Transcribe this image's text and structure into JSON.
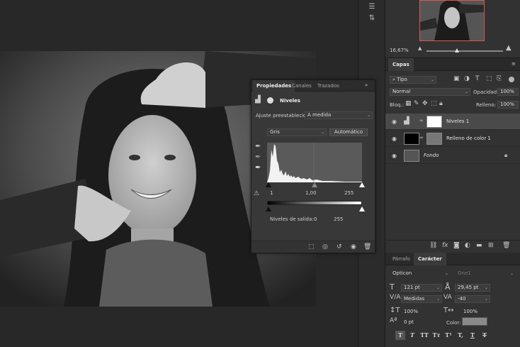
{
  "navigator": {
    "zoom": "16,67%"
  },
  "layers_panel": {
    "tab": "Capas",
    "filter": "Tipo",
    "blend_mode": "Normal",
    "opacity_label": "Opacidad:",
    "opacity_value": "100%",
    "lock_label": "Bloq.:",
    "fill_label": "Relleno:",
    "fill_value": "100%",
    "layers": [
      {
        "name": "Niveles 1",
        "selected": true
      },
      {
        "name": "Relleno de color 1",
        "selected": false
      },
      {
        "name": "Fondo",
        "selected": false
      }
    ]
  },
  "properties_panel": {
    "tabs": [
      "Propiedades",
      "Canales",
      "Trazados"
    ],
    "title": "Niveles",
    "preset_label": "Ajuste preestablecido:",
    "preset_value": "A medida",
    "channel": "Gris",
    "auto_button": "Automático",
    "input_black": "1",
    "input_gamma": "1,00",
    "input_white": "255",
    "output_label": "Niveles de salida:",
    "output_black": "0",
    "output_white": "255"
  },
  "character_panel": {
    "tabs": [
      "Párrafo",
      "Carácter"
    ],
    "font_family": "Opticon",
    "font_style": "One1",
    "font_size": "121 pt",
    "leading": "29,45 pt",
    "kerning": "Medidas",
    "tracking": "-40",
    "vertical_scale": "100%",
    "horizontal_scale": "100%",
    "baseline_shift": "0 pt",
    "color_label": "Color:",
    "style_buttons": [
      "T",
      "T",
      "TT",
      "Tт",
      "T¹",
      "T,",
      "T",
      "T"
    ]
  },
  "colors": {
    "selection_border": "#e0554f"
  }
}
